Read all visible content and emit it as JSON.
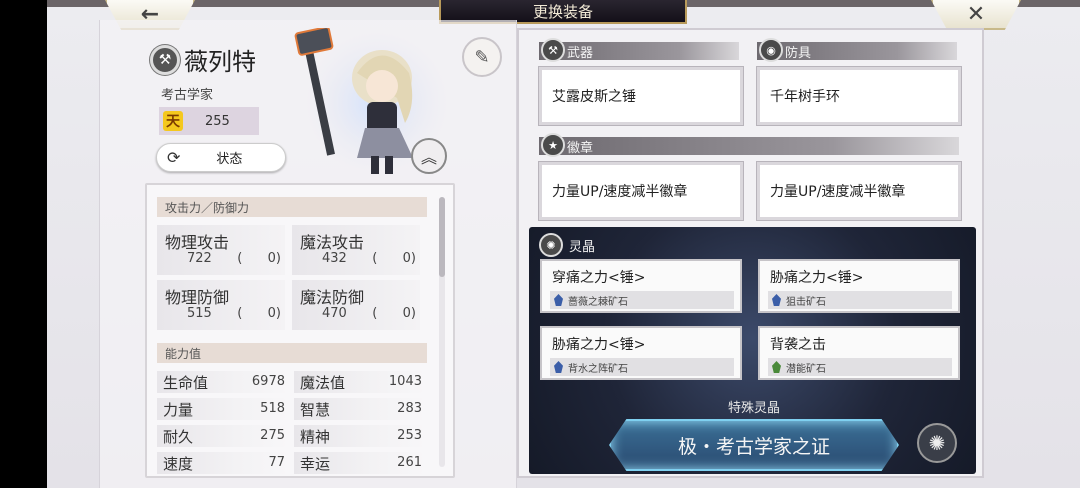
{
  "header": {
    "title": "更换装备",
    "back_icon": "←",
    "close_icon": "✕"
  },
  "character": {
    "name": "薇列特",
    "class": "考古学家",
    "rank_icon": "天",
    "rank_value": "255",
    "status_label": "状态"
  },
  "stats": {
    "atk_def_header": "攻击力／防御力",
    "tiles": [
      {
        "name": "物理攻击",
        "value": "722",
        "paren_open": "(",
        "bonus": "0)"
      },
      {
        "name": "魔法攻击",
        "value": "432",
        "paren_open": "(",
        "bonus": "0)"
      },
      {
        "name": "物理防御",
        "value": "515",
        "paren_open": "(",
        "bonus": "0)"
      },
      {
        "name": "魔法防御",
        "value": "470",
        "paren_open": "(",
        "bonus": "0)"
      }
    ],
    "ability_header": "能力值",
    "abilities": [
      {
        "name": "生命值",
        "value": "6978"
      },
      {
        "name": "魔法值",
        "value": "1043"
      },
      {
        "name": "力量",
        "value": "518"
      },
      {
        "name": "智慧",
        "value": "283"
      },
      {
        "name": "耐久",
        "value": "275"
      },
      {
        "name": "精神",
        "value": "253"
      },
      {
        "name": "速度",
        "value": "77"
      },
      {
        "name": "幸运",
        "value": "261"
      }
    ]
  },
  "equipment": {
    "weapon_label": "武器",
    "armor_label": "防具",
    "badge_label": "徽章",
    "weapon": "艾露皮斯之锤",
    "armor": "千年树手环",
    "badge1": "力量UP/速度减半徽章",
    "badge2": "力量UP/速度减半徽章"
  },
  "crystals": {
    "label": "灵晶",
    "items": [
      {
        "name": "穿痛之力<锤>",
        "ore": "蔷薇之棘矿石"
      },
      {
        "name": "胁痛之力<锤>",
        "ore": "狙击矿石"
      },
      {
        "name": "胁痛之力<锤>",
        "ore": "背水之阵矿石"
      },
      {
        "name": "背袭之击",
        "ore": "潜能矿石"
      }
    ],
    "special_label": "特殊灵晶",
    "special_button": "极・考古学家之证"
  }
}
